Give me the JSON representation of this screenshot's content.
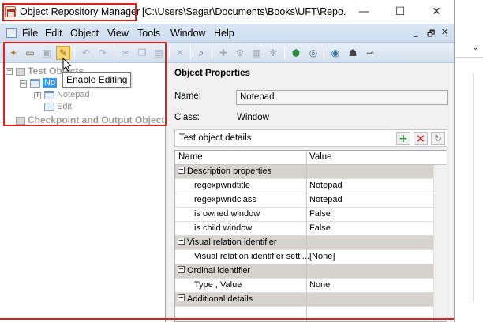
{
  "window": {
    "app_title": "Object Repository Manager",
    "path": "[C:\\Users\\Sagar\\Documents\\Books\\UFT\\Repo...",
    "minimize_label": "—",
    "maximize_label": "☐",
    "close_label": "✕"
  },
  "menu": {
    "items": [
      "File",
      "Edit",
      "Object",
      "View",
      "Tools",
      "Window",
      "Help"
    ],
    "mdi": {
      "minimize": "_",
      "restore": "🗗",
      "close": "✕"
    }
  },
  "toolbar": {
    "tooltip": "Enable Editing",
    "buttons": [
      {
        "icon": "new-icon",
        "glyph": "✦"
      },
      {
        "icon": "open-icon",
        "glyph": "▭"
      },
      {
        "icon": "save-icon",
        "glyph": "▣"
      },
      {
        "icon": "pencil-icon",
        "glyph": "✎"
      },
      {
        "icon": "undo-icon",
        "glyph": "↶"
      },
      {
        "icon": "redo-icon",
        "glyph": "↷"
      },
      {
        "icon": "cut-icon",
        "glyph": "✂"
      },
      {
        "icon": "copy-icon",
        "glyph": "❐"
      },
      {
        "icon": "paste-icon",
        "glyph": "▤"
      },
      {
        "icon": "delete-icon",
        "glyph": "✕"
      },
      {
        "icon": "find-icon",
        "glyph": "⌕"
      },
      {
        "icon": "add-objects-icon",
        "glyph": "✚"
      },
      {
        "icon": "update-icon",
        "glyph": "⚙"
      },
      {
        "icon": "capture-icon",
        "glyph": "▦"
      },
      {
        "icon": "snowflake-icon",
        "glyph": "✻"
      },
      {
        "icon": "cube-icon",
        "glyph": "⬢"
      },
      {
        "icon": "highlight-icon",
        "glyph": "◎"
      },
      {
        "icon": "binoculars-icon",
        "glyph": "◉"
      },
      {
        "icon": "spy-icon",
        "glyph": "☗"
      },
      {
        "icon": "link-icon",
        "glyph": "⊸"
      }
    ]
  },
  "tree": {
    "root": "Test Objects",
    "selected": "No",
    "children": [
      "Notepad",
      "Edit"
    ],
    "checkpoints": "Checkpoint and Output Objects"
  },
  "properties": {
    "title": "Object Properties",
    "name_label": "Name:",
    "name_value": "Notepad",
    "class_label": "Class:",
    "class_value": "Window",
    "details_title": "Test object details",
    "columns": [
      "Name",
      "Value"
    ],
    "rows": [
      {
        "type": "category",
        "name": "Description properties",
        "value": ""
      },
      {
        "type": "row",
        "name": "regexpwndtitle",
        "value": "Notepad"
      },
      {
        "type": "row",
        "name": "regexpwndclass",
        "value": "Notepad"
      },
      {
        "type": "row",
        "name": "is owned window",
        "value": "False"
      },
      {
        "type": "row",
        "name": "is child window",
        "value": "False"
      },
      {
        "type": "category",
        "name": "Visual relation identifier",
        "value": ""
      },
      {
        "type": "row",
        "name": "Visual relation identifier setti...",
        "value": "[None]"
      },
      {
        "type": "category",
        "name": "Ordinal identifier",
        "value": ""
      },
      {
        "type": "row",
        "name": "Type , Value",
        "value": "None"
      },
      {
        "type": "category",
        "name": "Additional details",
        "value": ""
      }
    ]
  },
  "colors": {
    "highlight_red": "#e0201a",
    "menubar": "#cddcef",
    "selection": "#3399ff",
    "category_row": "#d6d3ce"
  }
}
